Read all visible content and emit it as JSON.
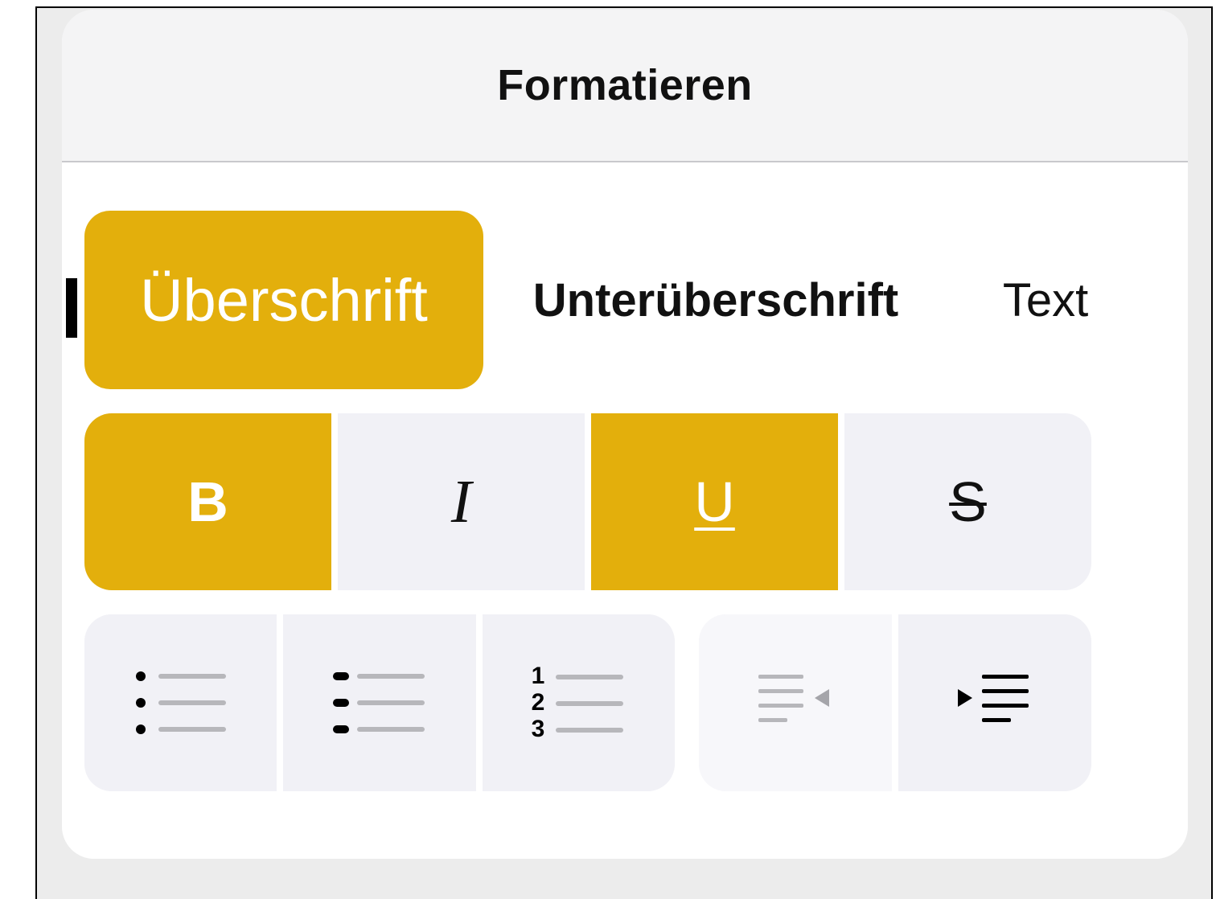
{
  "popover": {
    "title": "Formatieren"
  },
  "paragraph_styles": [
    {
      "label": "Überschrift",
      "selected": true
    },
    {
      "label": "Unterüberschrift",
      "selected": false
    },
    {
      "label": "Text",
      "selected": false
    }
  ],
  "text_styles": {
    "bold": {
      "glyph": "B",
      "selected": true
    },
    "italic": {
      "glyph": "I",
      "selected": false
    },
    "underline": {
      "glyph": "U",
      "selected": true
    },
    "strikethrough": {
      "glyph": "S",
      "selected": false
    }
  },
  "list_styles": {
    "numbered_digits": [
      "1",
      "2",
      "3"
    ]
  },
  "colors": {
    "accent": "#e3af0c",
    "segment_bg": "#f1f1f6",
    "header_bg": "#f4f4f5",
    "frame_bg": "#ececec"
  },
  "icons": [
    "bulleted-list-icon",
    "dashed-list-icon",
    "numbered-list-icon",
    "outdent-icon",
    "indent-icon"
  ]
}
